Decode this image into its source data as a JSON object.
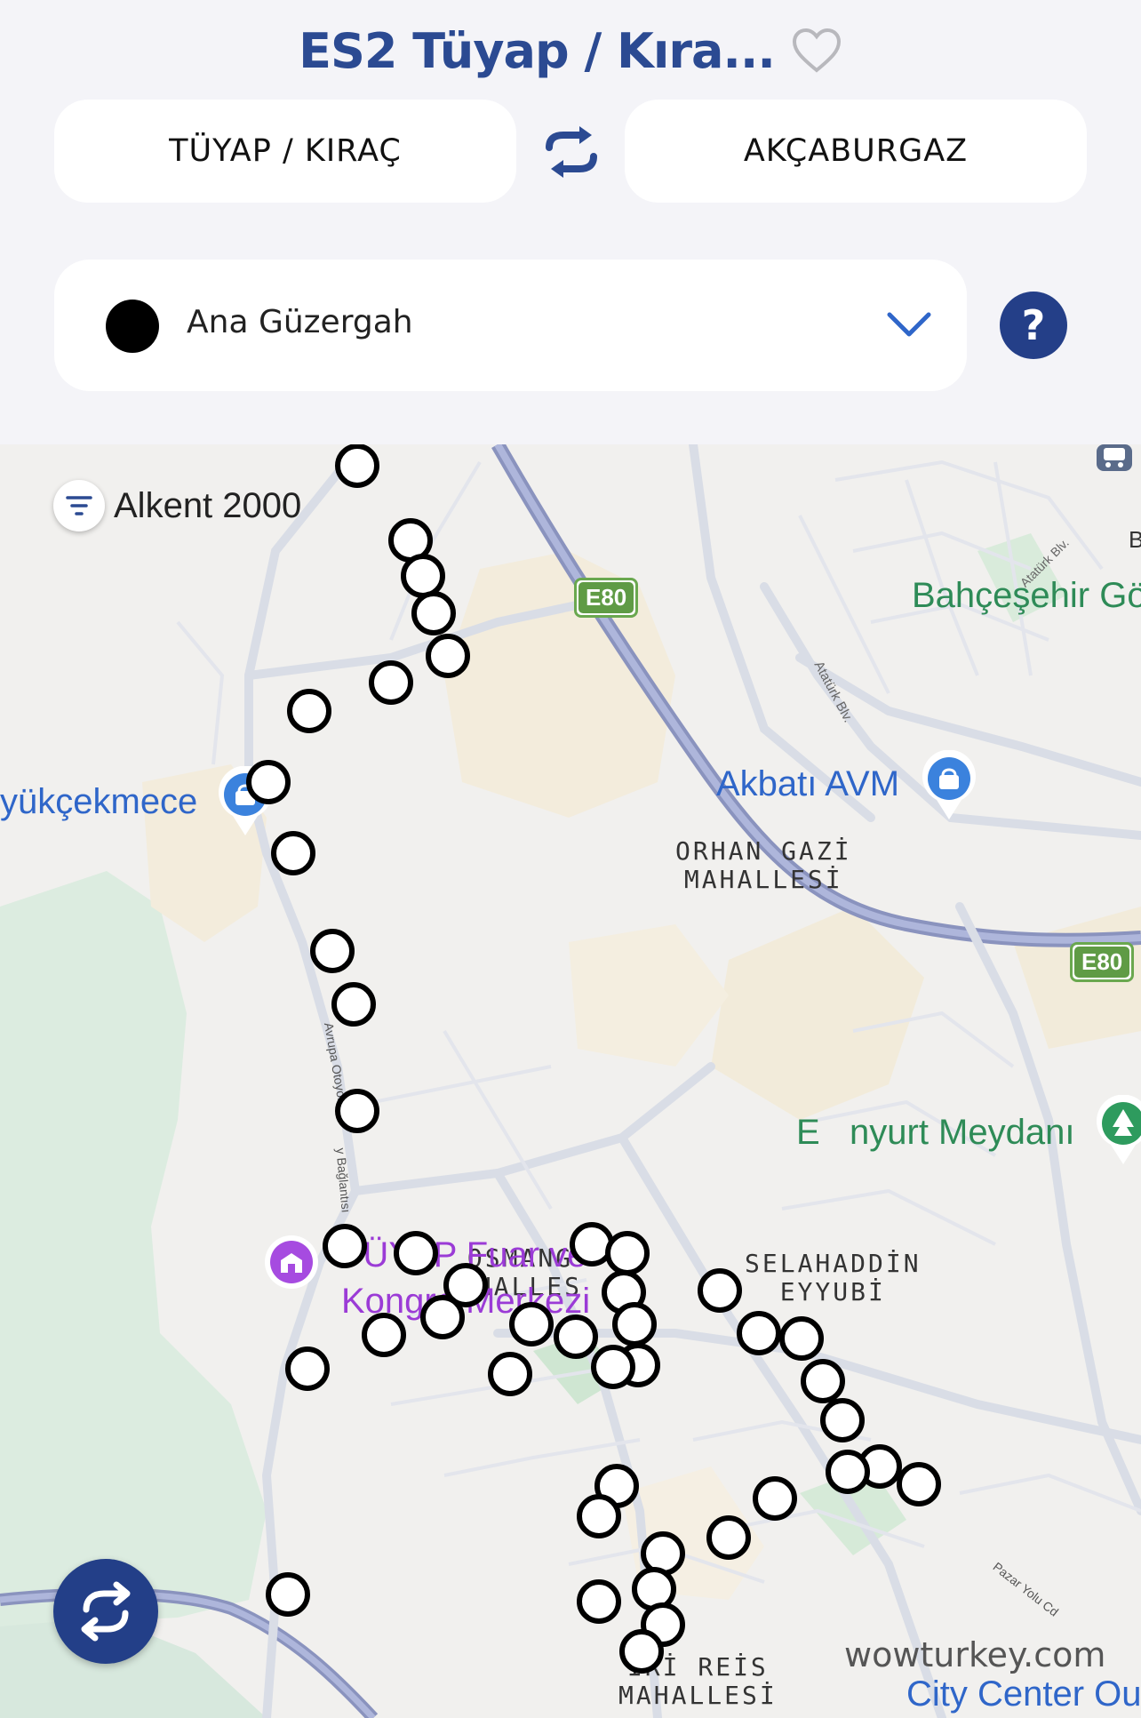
{
  "header": {
    "title": "ES2 Tüyap / Kıra..."
  },
  "stops": {
    "from": "TÜYAP / KIRAÇ",
    "to": "AKÇABURGAZ"
  },
  "route": {
    "selected": "Ana Güzergah",
    "color": "#000000"
  },
  "help": {
    "label": "?"
  },
  "map": {
    "alkent": "Alkent 2000",
    "district_orhan": "ORHAN GAZİ\nMAHALLESİ",
    "district_osman": "OSMANG\nAHALLES",
    "district_selahaddin": "SELAHADDİN\nEYYUBİ",
    "district_piri": "İRİ REİS\nMAHALLESİ",
    "poi_akbati": "Akbatı AVM",
    "poi_buyukcekmece": "yükçekmece",
    "poi_bahcesehir": "Bahçeşehir Gö",
    "poi_esenyurt": "E   nyurt Meydanı",
    "poi_tuyap_line1": "TÜYAP Fuar ve",
    "poi_tuyap_line2": "Kongre Merkezi",
    "poi_citycenter": "City Center Ou",
    "hw1": "E80",
    "hw2": "E80",
    "road_ataturk1": "Atatürk Blv.",
    "road_ataturk2": "Atatürk Blv.",
    "road_avrupa": "Avrupa Otoyolu",
    "road_baglantisi": "y Bağlantısı",
    "road_pazar": "Pazar Yolu Cd",
    "edge_b": "B",
    "watermark": "wowturkey.com"
  },
  "colors": {
    "accent": "#2b4a92",
    "button": "#243f88"
  }
}
